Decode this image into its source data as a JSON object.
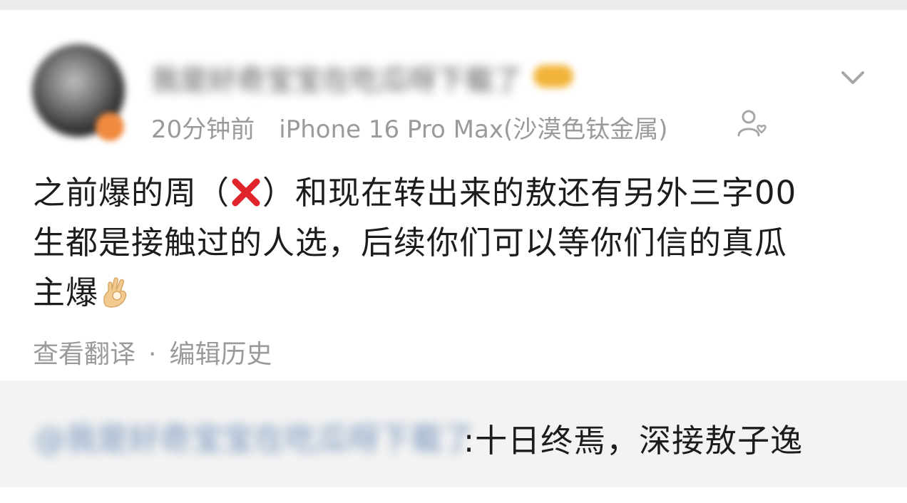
{
  "post": {
    "username": "我是好奇宝宝在吃瓜呀下载了",
    "time": "20分钟前",
    "device": "iPhone 16 Pro Max(沙漠色钛金属)",
    "content": {
      "line1_before_icon": "之前爆的周（",
      "line1_after_icon": "）和现在转出来的敖还有另外三字00",
      "line2": "生都是接触过的人选，后续你们可以等你们信的真瓜",
      "line3": "主爆"
    },
    "icons": {
      "cross": "cross-mark-icon",
      "ok_hand": "ok-hand-icon",
      "more": "chevron-down-icon",
      "follow": "follow-user-icon"
    },
    "actions": {
      "translate": "查看翻译",
      "separator": "·",
      "edit_history": "编辑历史"
    }
  },
  "comment": {
    "username": "@我是好奇宝宝在吃瓜呀下载了",
    "text": ":十日终焉，深接敖子逸"
  },
  "colors": {
    "meta_gray": "#9a9a9a",
    "text_dark": "#1c1c1c",
    "comment_bg": "#f3f3f3",
    "link_blue": "#6f8fb8",
    "cross_red": "#e0242b"
  }
}
